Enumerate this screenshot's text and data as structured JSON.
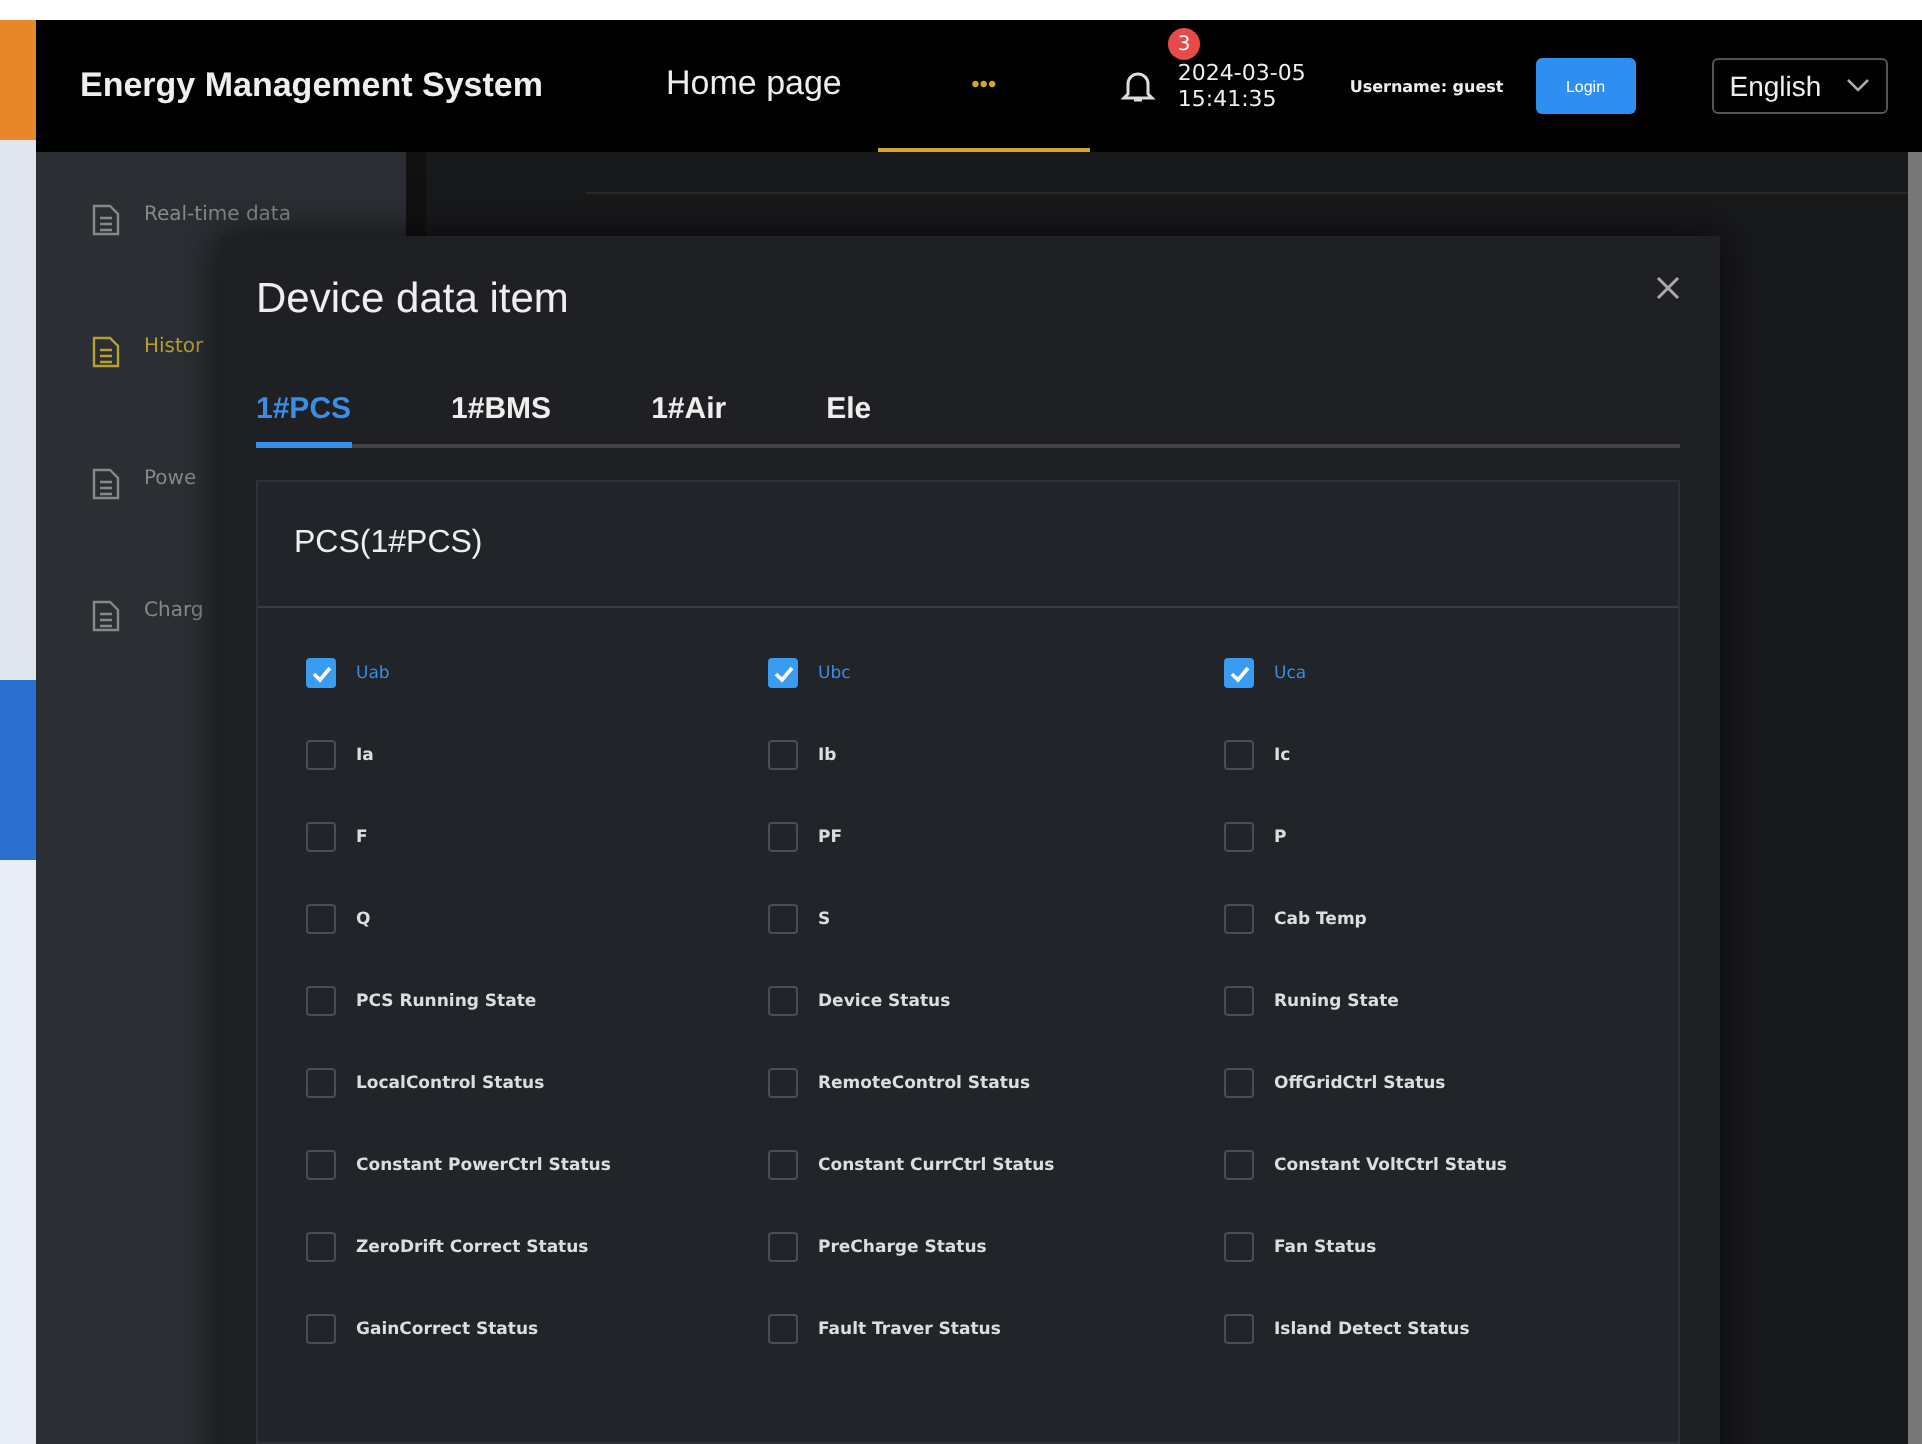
{
  "header": {
    "title": "Energy Management System",
    "nav": [
      {
        "label": "Home page",
        "selected": false
      },
      {
        "label": "•••",
        "selected": true
      }
    ],
    "notifications": {
      "count": "3"
    },
    "date": "2024-03-05",
    "time": "15:41:35",
    "username": "Username:  guest",
    "login_button": "Login",
    "language": "English"
  },
  "sidebar": {
    "items": [
      {
        "label": "Real-time data",
        "selected": false
      },
      {
        "label": "Histor",
        "selected": true
      },
      {
        "label": "Powe",
        "selected": false
      },
      {
        "label": "Charg",
        "selected": false
      }
    ]
  },
  "dialog": {
    "title": "Device data item",
    "tabs": [
      {
        "label": "1#PCS",
        "selected": true
      },
      {
        "label": "1#BMS",
        "selected": false
      },
      {
        "label": "1#Air",
        "selected": false
      },
      {
        "label": "Ele",
        "selected": false
      }
    ],
    "section_title": "PCS(1#PCS)",
    "items": [
      {
        "label": "Uab",
        "checked": true
      },
      {
        "label": "Ubc",
        "checked": true
      },
      {
        "label": "Uca",
        "checked": true
      },
      {
        "label": "Ia",
        "checked": false
      },
      {
        "label": "Ib",
        "checked": false
      },
      {
        "label": "Ic",
        "checked": false
      },
      {
        "label": "F",
        "checked": false
      },
      {
        "label": "PF",
        "checked": false
      },
      {
        "label": "P",
        "checked": false
      },
      {
        "label": "Q",
        "checked": false
      },
      {
        "label": "S",
        "checked": false
      },
      {
        "label": "Cab Temp",
        "checked": false
      },
      {
        "label": "PCS Running State",
        "checked": false
      },
      {
        "label": "Device Status",
        "checked": false
      },
      {
        "label": "Runing State",
        "checked": false
      },
      {
        "label": "LocalControl Status",
        "checked": false
      },
      {
        "label": "RemoteControl Status",
        "checked": false
      },
      {
        "label": "OffGridCtrl Status",
        "checked": false
      },
      {
        "label": "Constant PowerCtrl Status",
        "checked": false
      },
      {
        "label": "Constant CurrCtrl Status",
        "checked": false
      },
      {
        "label": "Constant VoltCtrl Status",
        "checked": false
      },
      {
        "label": "ZeroDrift Correct Status",
        "checked": false
      },
      {
        "label": "PreCharge Status",
        "checked": false
      },
      {
        "label": "Fan Status",
        "checked": false
      },
      {
        "label": "GainCorrect Status",
        "checked": false
      },
      {
        "label": "Fault Traver Status",
        "checked": false
      },
      {
        "label": "Island Detect Status",
        "checked": false
      }
    ]
  }
}
